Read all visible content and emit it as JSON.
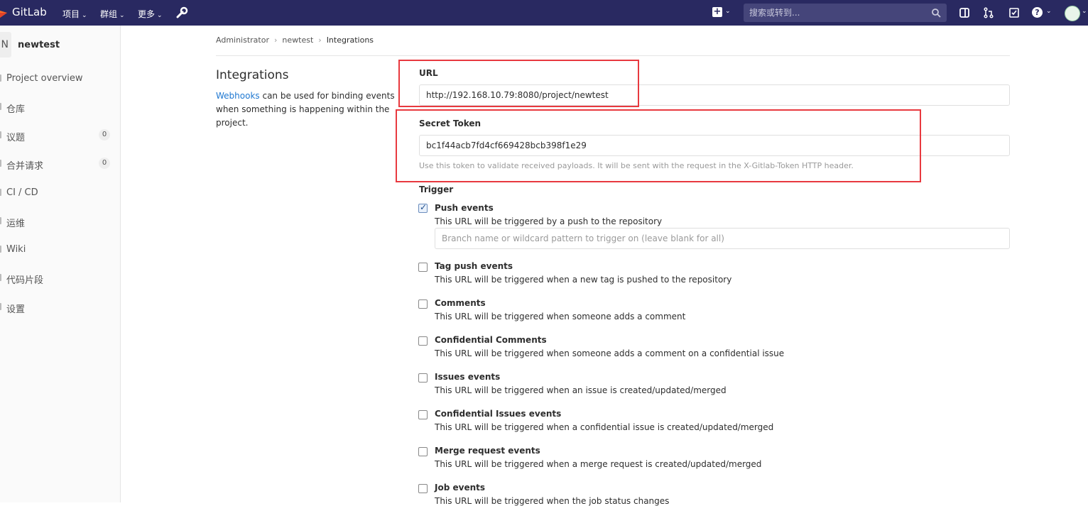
{
  "topbar": {
    "brand": "GitLab",
    "nav": [
      {
        "label": "项目"
      },
      {
        "label": "群组"
      },
      {
        "label": "更多"
      }
    ],
    "search_placeholder": "搜索或转到...",
    "help_label": "?"
  },
  "sidebar": {
    "project_initial": "N",
    "project_name": "newtest",
    "items": [
      {
        "label": "Project overview"
      },
      {
        "label": "仓库"
      },
      {
        "label": "议题",
        "count": "0"
      },
      {
        "label": "合并请求",
        "count": "0"
      },
      {
        "label": "CI / CD"
      },
      {
        "label": "运维"
      },
      {
        "label": "Wiki"
      },
      {
        "label": "代码片段"
      },
      {
        "label": "设置"
      }
    ]
  },
  "breadcrumb": [
    "Administrator",
    "newtest",
    "Integrations"
  ],
  "page": {
    "title": "Integrations",
    "desc_link": "Webhooks",
    "desc_text": " can be used for binding events when something is happening within the project."
  },
  "form": {
    "url_label": "URL",
    "url_value": "http://192.168.10.79:8080/project/newtest",
    "token_label": "Secret Token",
    "token_value": "bc1f44acb7fd4cf669428bcb398f1e29",
    "token_help": "Use this token to validate received payloads. It will be sent with the request in the X-Gitlab-Token HTTP header.",
    "trigger_label": "Trigger",
    "branch_placeholder": "Branch name or wildcard pattern to trigger on (leave blank for all)"
  },
  "events": [
    {
      "title": "Push events",
      "desc": "This URL will be triggered by a push to the repository",
      "checked": true
    },
    {
      "title": "Tag push events",
      "desc": "This URL will be triggered when a new tag is pushed to the repository",
      "checked": false
    },
    {
      "title": "Comments",
      "desc": "This URL will be triggered when someone adds a comment",
      "checked": false
    },
    {
      "title": "Confidential Comments",
      "desc": "This URL will be triggered when someone adds a comment on a confidential issue",
      "checked": false
    },
    {
      "title": "Issues events",
      "desc": "This URL will be triggered when an issue is created/updated/merged",
      "checked": false
    },
    {
      "title": "Confidential Issues events",
      "desc": "This URL will be triggered when a confidential issue is created/updated/merged",
      "checked": false
    },
    {
      "title": "Merge request events",
      "desc": "This URL will be triggered when a merge request is created/updated/merged",
      "checked": false
    },
    {
      "title": "Job events",
      "desc": "This URL will be triggered when the job status changes",
      "checked": false
    }
  ],
  "colors": {
    "navbar": "#292961",
    "highlight_box": "#e8393f",
    "link": "#1f78d1"
  }
}
